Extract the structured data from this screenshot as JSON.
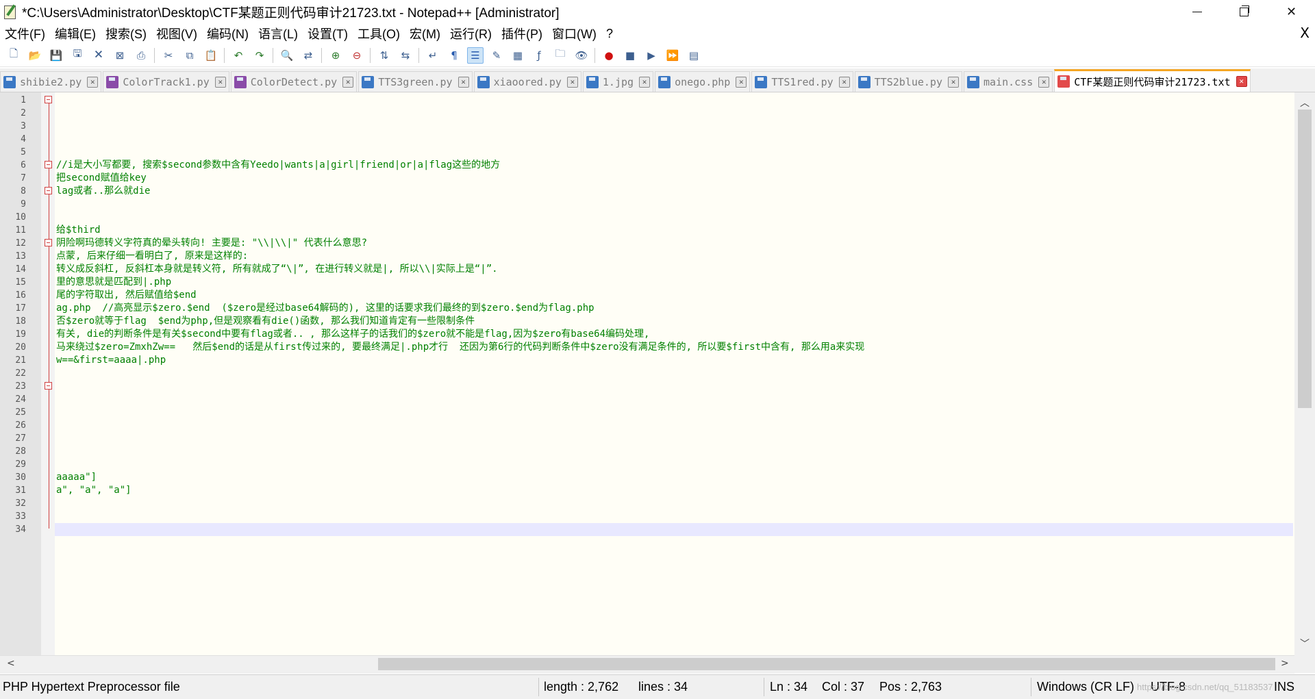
{
  "window": {
    "title": "*C:\\Users\\Administrator\\Desktop\\CTF某题正则代码审计21723.txt - Notepad++ [Administrator]",
    "minimize": "—",
    "restore": "❐",
    "close": "✕"
  },
  "menu": {
    "items": [
      "文件(F)",
      "编辑(E)",
      "搜索(S)",
      "视图(V)",
      "编码(N)",
      "语言(L)",
      "设置(T)",
      "工具(O)",
      "宏(M)",
      "运行(R)",
      "插件(P)",
      "窗口(W)",
      "?"
    ],
    "close_label": "X"
  },
  "toolbar": {
    "icons": [
      "new-file-icon",
      "open-file-icon",
      "save-icon",
      "save-all-icon",
      "close-icon",
      "close-all-icon",
      "print-icon",
      "|",
      "cut-icon",
      "copy-icon",
      "paste-icon",
      "|",
      "undo-icon",
      "redo-icon",
      "|",
      "find-icon",
      "replace-icon",
      "|",
      "zoom-in-icon",
      "zoom-out-icon",
      "|",
      "sync-vertical-icon",
      "sync-horizontal-icon",
      "|",
      "word-wrap-icon",
      "show-all-chars-icon",
      "indent-guide-icon",
      "user-defined-lang-icon",
      "document-map-icon",
      "function-list-icon",
      "folder-workspace-icon",
      "monitor-icon",
      "|",
      "record-macro-icon",
      "stop-macro-icon",
      "play-macro-icon",
      "run-macro-multiple-icon",
      "save-macro-icon"
    ]
  },
  "tabs": [
    {
      "label": "shibie2.py",
      "color": "#3b78c4",
      "active": false
    },
    {
      "label": "ColorTrack1.py",
      "color": "#8a4ba8",
      "active": false
    },
    {
      "label": "ColorDetect.py",
      "color": "#8a4ba8",
      "active": false
    },
    {
      "label": "TTS3green.py",
      "color": "#3b78c4",
      "active": false
    },
    {
      "label": "xiaoored.py",
      "color": "#3b78c4",
      "active": false
    },
    {
      "label": "1.jpg",
      "color": "#3b78c4",
      "active": false
    },
    {
      "label": "onego.php",
      "color": "#3b78c4",
      "active": false
    },
    {
      "label": "TTS1red.py",
      "color": "#3b78c4",
      "active": false
    },
    {
      "label": "TTS2blue.py",
      "color": "#3b78c4",
      "active": false
    },
    {
      "label": "main.css",
      "color": "#3b78c4",
      "active": false
    },
    {
      "label": "CTF某题正则代码审计21723.txt",
      "color": "#e24a4a",
      "active": true
    }
  ],
  "editor": {
    "current_line": 34,
    "lines": [
      {
        "n": "1",
        "text": ""
      },
      {
        "n": "2",
        "text": ""
      },
      {
        "n": "3",
        "text": ""
      },
      {
        "n": "4",
        "text": ""
      },
      {
        "n": "5",
        "text": ""
      },
      {
        "n": "6",
        "text": "//i是大小写都要, 搜索$second参数中含有Yeedo|wants|a|girl|friend|or|a|flag这些的地方"
      },
      {
        "n": "7",
        "text": "把second赋值给key"
      },
      {
        "n": "8",
        "text": "lag或者..那么就die"
      },
      {
        "n": "9",
        "text": ""
      },
      {
        "n": "10",
        "text": ""
      },
      {
        "n": "11",
        "text": "给$third"
      },
      {
        "n": "12",
        "text": "阴险啊玛德转义字符真的晕头转向! 主要是: \"\\\\|\\\\|\" 代表什么意思?"
      },
      {
        "n": "13",
        "text": "点蒙, 后来仔细一看明白了, 原来是这样的:"
      },
      {
        "n": "14",
        "text": "转义成反斜杠, 反斜杠本身就是转义符, 所有就成了“\\|”, 在进行转义就是|, 所以\\\\|实际上是“|”."
      },
      {
        "n": "15",
        "text": "里的意思就是匹配到|.php"
      },
      {
        "n": "16",
        "text": "尾的字符取出, 然后赋值给$end"
      },
      {
        "n": "17",
        "text": "ag.php  //高亮显示$zero.$end  ($zero是经过base64解码的), 这里的话要求我们最终的到$zero.$end为flag.php"
      },
      {
        "n": "18",
        "text": "否$zero就等于flag  $end为php,但是观察看有die()函数, 那么我们知道肯定有一些限制条件"
      },
      {
        "n": "19",
        "text": "有关, die的判断条件是有关$second中要有flag或者.. , 那么这样子的话我们的$zero就不能是flag,因为$zero有base64编码处理,"
      },
      {
        "n": "20",
        "text": "马来绕过$zero=ZmxhZw==   然后$end的话是从first传过来的, 要最终满足|.php才行  还因为第6行的代码判断条件中$zero没有满足条件的, 所以要$first中含有, 那么用a来实现"
      },
      {
        "n": "21",
        "text": "w==&first=aaaa|.php"
      },
      {
        "n": "22",
        "text": ""
      },
      {
        "n": "23",
        "text": ""
      },
      {
        "n": "24",
        "text": ""
      },
      {
        "n": "25",
        "text": ""
      },
      {
        "n": "26",
        "text": ""
      },
      {
        "n": "27",
        "text": ""
      },
      {
        "n": "28",
        "text": ""
      },
      {
        "n": "29",
        "text": ""
      },
      {
        "n": "30",
        "text": "aaaaa\"]"
      },
      {
        "n": "31",
        "text": "a\", \"a\", \"a\"]"
      },
      {
        "n": "32",
        "text": ""
      },
      {
        "n": "33",
        "text": ""
      },
      {
        "n": "34",
        "text": ""
      }
    ]
  },
  "status": {
    "file_type": "PHP Hypertext Preprocessor file",
    "length": "length : 2,762",
    "lines": "lines : 34",
    "ln": "Ln : 34",
    "col": "Col : 37",
    "pos": "Pos : 2,763",
    "eol": "Windows (CR LF)",
    "encoding": "UTF-8",
    "mode": "INS",
    "watermark": "https://blog.csdn.net/qq_51183537"
  }
}
